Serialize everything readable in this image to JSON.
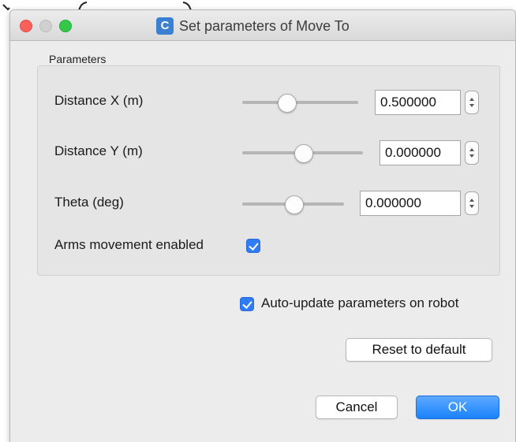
{
  "window": {
    "title": "Set parameters of Move To",
    "app_icon_letter": "C"
  },
  "parameters": {
    "group_title": "Parameters",
    "rows": [
      {
        "label": "Distance X (m)",
        "value": "0.500000",
        "slider_fraction": 0.38
      },
      {
        "label": "Distance Y (m)",
        "value": "0.000000",
        "slider_fraction": 0.5
      },
      {
        "label": "Theta (deg)",
        "value": "0.000000",
        "slider_fraction": 0.5
      }
    ],
    "arms_movement": {
      "label": "Arms movement enabled",
      "checked": true
    }
  },
  "auto_update": {
    "label": "Auto-update parameters on robot",
    "checked": true
  },
  "buttons": {
    "reset": "Reset to default",
    "cancel": "Cancel",
    "ok": "OK"
  },
  "colors": {
    "accent": "#2f7cf6",
    "close": "#fc605b",
    "zoom": "#34c84a"
  }
}
